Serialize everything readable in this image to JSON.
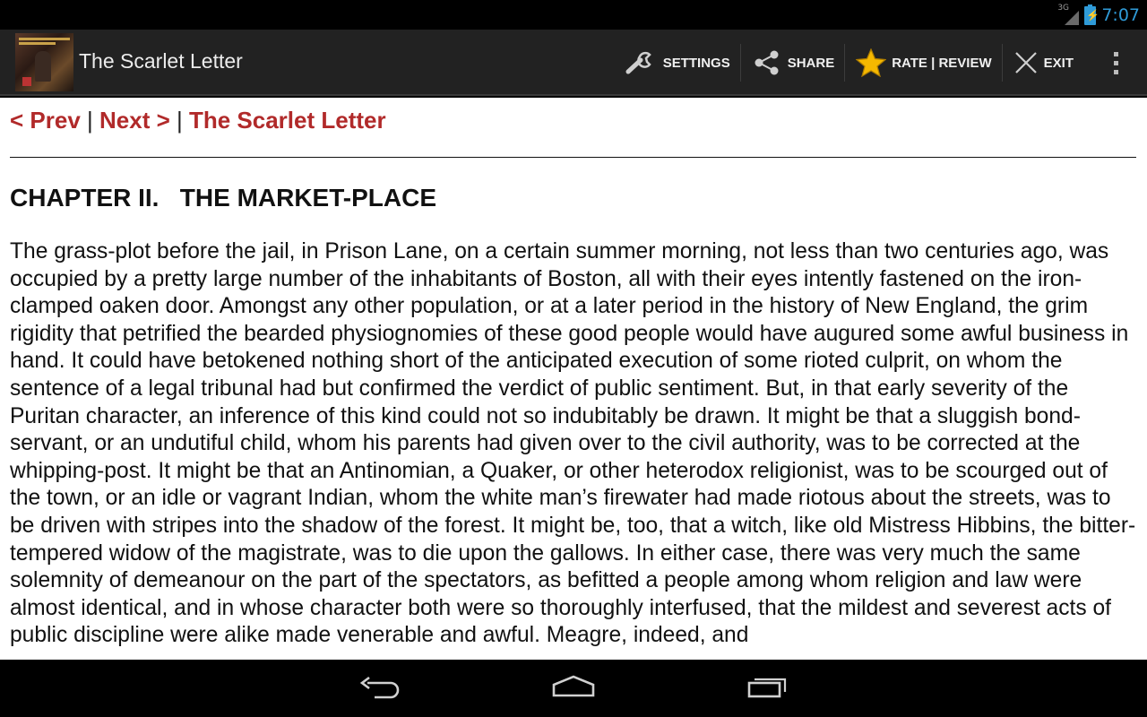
{
  "status_bar": {
    "network": "3G",
    "time": "7:07"
  },
  "action_bar": {
    "title": "The Scarlet Letter",
    "actions": [
      {
        "label": "SETTINGS",
        "icon": "wrench-icon"
      },
      {
        "label": "SHARE",
        "icon": "share-icon"
      },
      {
        "label": "RATE | REVIEW",
        "icon": "star-icon"
      },
      {
        "label": "EXIT",
        "icon": "close-icon"
      }
    ],
    "overflow_icon": "more-vertical-icon"
  },
  "nav": {
    "prev": "< Prev",
    "sep1": " | ",
    "next": "Next >",
    "sep2": " | ",
    "book": "The Scarlet Letter"
  },
  "chapter_title": "CHAPTER II.   THE MARKET-PLACE",
  "body_text": "The grass-plot before the jail, in Prison Lane, on a certain summer morning, not less than two centuries ago, was occupied by a pretty large number of the inhabitants of Boston, all with their eyes intently fastened on the iron-clamped oaken door. Amongst any other population, or at a later period in the history of New England, the grim rigidity that petrified the bearded physiognomies of these good people would have augured some awful business in hand. It could have betokened nothing short of the anticipated execution of some rioted culprit, on whom the sentence of a legal tribunal had but confirmed the verdict of public sentiment. But, in that early severity of the Puritan character, an inference of this kind could not so indubitably be drawn. It might be that a sluggish bond-servant, or an undutiful child, whom his parents had given over to the civil authority, was to be corrected at the whipping-post. It might be that an Antinomian, a Quaker, or other heterodox religionist, was to be scourged out of the town, or an idle or vagrant Indian, whom the white man’s firewater had made riotous about the streets, was to be driven with stripes into the shadow of the forest. It might be, too, that a witch, like old Mistress Hibbins, the bitter-tempered widow of the magistrate, was to die upon the gallows. In either case, there was very much the same solemnity of demeanour on the part of the spectators, as befitted a people among whom religion and law were almost identical, and in whose character both were so thoroughly interfused, that the mildest and severest acts of public discipline were alike made venerable and awful. Meagre, indeed, and",
  "system_nav": {
    "back_icon": "back-icon",
    "home_icon": "home-icon",
    "recents_icon": "recent-apps-icon"
  },
  "colors": {
    "link": "#b12a2a",
    "accent": "#2f9bd8",
    "actionbar": "#222222"
  }
}
